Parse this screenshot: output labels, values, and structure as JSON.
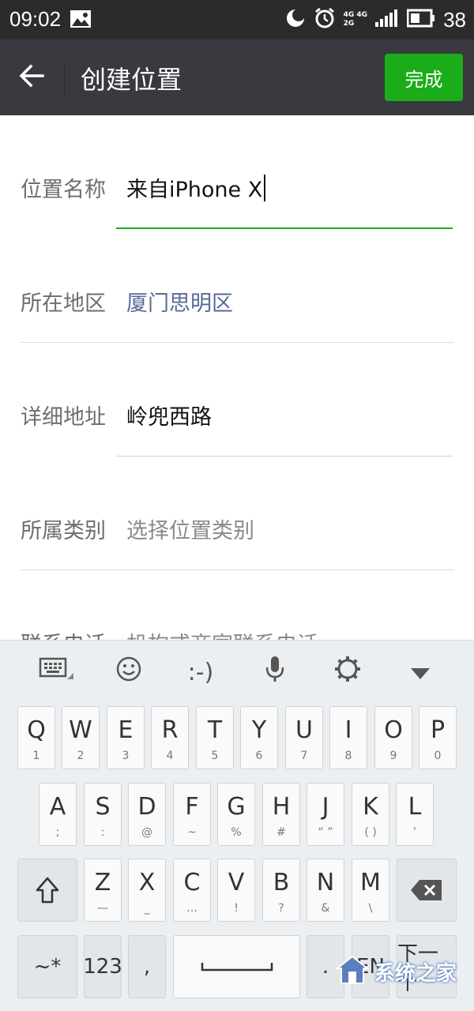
{
  "status_bar": {
    "time": "09:02",
    "network_top": "4G 4G",
    "network_bottom": "2G",
    "battery": "38"
  },
  "header": {
    "title": "创建位置",
    "done_label": "完成"
  },
  "form": {
    "rows": [
      {
        "label": "位置名称",
        "value": "来自iPhone X"
      },
      {
        "label": "所在地区",
        "value": "厦门思明区"
      },
      {
        "label": "详细地址",
        "value": "岭兜西路"
      },
      {
        "label": "所属类别",
        "placeholder": "选择位置类别"
      },
      {
        "label": "联系电话",
        "placeholder": "机构或商家联系电话"
      }
    ]
  },
  "keyboard": {
    "toolbar": {
      "emoticon": ":-)"
    },
    "row1": [
      {
        "main": "Q",
        "sub": "1"
      },
      {
        "main": "W",
        "sub": "2"
      },
      {
        "main": "E",
        "sub": "3"
      },
      {
        "main": "R",
        "sub": "4"
      },
      {
        "main": "T",
        "sub": "5"
      },
      {
        "main": "Y",
        "sub": "6"
      },
      {
        "main": "U",
        "sub": "7"
      },
      {
        "main": "I",
        "sub": "8"
      },
      {
        "main": "O",
        "sub": "9"
      },
      {
        "main": "P",
        "sub": "0"
      }
    ],
    "row2": [
      {
        "main": "A",
        "sub": ";"
      },
      {
        "main": "S",
        "sub": ":"
      },
      {
        "main": "D",
        "sub": "@"
      },
      {
        "main": "F",
        "sub": "~"
      },
      {
        "main": "G",
        "sub": "%"
      },
      {
        "main": "H",
        "sub": "#"
      },
      {
        "main": "J",
        "sub": "“ ”"
      },
      {
        "main": "K",
        "sub": "( )"
      },
      {
        "main": "L",
        "sub": "’"
      }
    ],
    "row3": [
      {
        "main": "Z",
        "sub": "—"
      },
      {
        "main": "X",
        "sub": "_"
      },
      {
        "main": "C",
        "sub": "…"
      },
      {
        "main": "V",
        "sub": "!"
      },
      {
        "main": "B",
        "sub": "?"
      },
      {
        "main": "N",
        "sub": "&"
      },
      {
        "main": "M",
        "sub": "\\"
      }
    ],
    "row4": {
      "symbols": "~*",
      "numbers": "123",
      "comma": ",",
      "period": ".",
      "lang": "EN",
      "next": "下一个"
    }
  },
  "watermark": {
    "text": "系统之家"
  }
}
